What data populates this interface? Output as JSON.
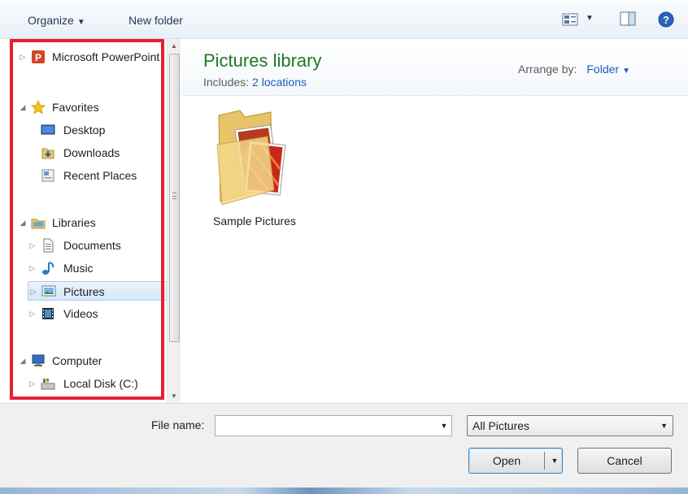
{
  "toolbar": {
    "organize_label": "Organize",
    "new_folder_label": "New folder",
    "icons": [
      "view-icon",
      "preview-pane-icon",
      "help-icon"
    ]
  },
  "nav": {
    "items": [
      {
        "label": "Microsoft PowerPoint",
        "icon": "powerpoint-icon",
        "expanded": false
      },
      {
        "label": "Favorites",
        "icon": "star-icon",
        "expanded": true
      },
      {
        "label": "Desktop",
        "icon": "desktop-icon"
      },
      {
        "label": "Downloads",
        "icon": "downloads-icon"
      },
      {
        "label": "Recent Places",
        "icon": "recent-places-icon"
      },
      {
        "label": "Libraries",
        "icon": "libraries-icon",
        "expanded": true
      },
      {
        "label": "Documents",
        "icon": "documents-icon",
        "expanded": false
      },
      {
        "label": "Music",
        "icon": "music-icon",
        "expanded": false
      },
      {
        "label": "Pictures",
        "icon": "pictures-icon",
        "expanded": false,
        "selected": true
      },
      {
        "label": "Videos",
        "icon": "videos-icon",
        "expanded": false
      },
      {
        "label": "Computer",
        "icon": "computer-icon",
        "expanded": true
      },
      {
        "label": "Local Disk (C:)",
        "icon": "local-disk-icon",
        "expanded": false
      }
    ]
  },
  "library": {
    "title": "Pictures library",
    "includes_label": "Includes:",
    "includes_link": "2 locations",
    "arrange_label": "Arrange by:",
    "arrange_value": "Folder"
  },
  "files": [
    {
      "label": "Sample Pictures",
      "icon": "folder-icon"
    }
  ],
  "bottom": {
    "file_name_label": "File name:",
    "file_name_value": "",
    "file_type": "All Pictures",
    "open_label": "Open",
    "cancel_label": "Cancel"
  },
  "colors": {
    "highlight_border": "#e6202e",
    "library_title": "#1e7a25",
    "link": "#1a5fb4"
  }
}
